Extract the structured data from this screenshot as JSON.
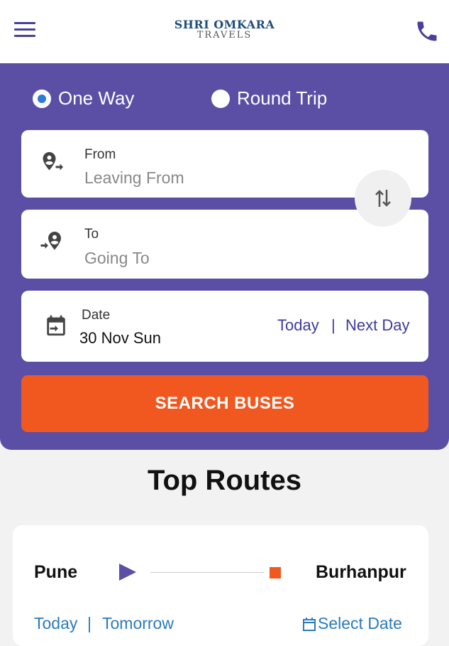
{
  "header": {
    "logo_line1": "SHRI OMKARA",
    "logo_line2": "TRAVELS",
    "menu_icon": "hamburger-menu-icon",
    "phone_icon": "phone-icon"
  },
  "trip_type": {
    "options": [
      {
        "label": "One Way",
        "selected": true
      },
      {
        "label": "Round Trip",
        "selected": false
      }
    ]
  },
  "from_field": {
    "label": "From",
    "placeholder": "Leaving From"
  },
  "to_field": {
    "label": "To",
    "placeholder": "Going To"
  },
  "date_field": {
    "label": "Date",
    "value": "30 Nov Sun",
    "quick_options": [
      "Today",
      "Next Day"
    ],
    "separator": "|"
  },
  "search_button": {
    "label": "SEARCH BUSES"
  },
  "top_routes": {
    "title": "Top Routes",
    "routes": [
      {
        "from": "Pune",
        "to": "Burhanpur",
        "quick_dates": [
          "Today",
          "Tomorrow"
        ],
        "separator": "|",
        "select_date_label": "Select Date"
      }
    ]
  },
  "colors": {
    "panel": "#5a4fa5",
    "accent_orange": "#f0581f",
    "link_blue": "#2b7bbf",
    "route_start": "#5a4fa5",
    "route_end": "#f0581f"
  }
}
